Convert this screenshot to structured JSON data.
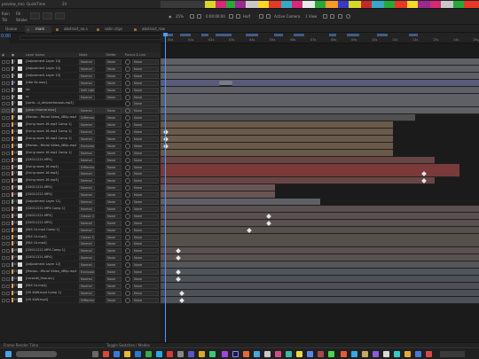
{
  "topbar": {
    "labels": [
      "preview\nrmo",
      "Quick Time",
      "24",
      "00",
      "0:00:00:00",
      "Half",
      "Active Camera",
      "1 View"
    ],
    "title_left": "preview_rmo",
    "quick_time": "QuickTime",
    "frame_value": "24"
  },
  "viewer": {
    "zoom": "25%",
    "timecode_small": "0:00:00:00",
    "resolution": "Half",
    "camera": "Active Camera",
    "views": "1 View",
    "left_items": [
      "Rain",
      "Fill",
      "Tilt",
      "Stroke"
    ]
  },
  "tabs": [
    {
      "label": "Queue",
      "active": false
    },
    {
      "label": "mark",
      "active": true
    },
    {
      "label": "abstract_no.s",
      "active": false
    },
    {
      "label": "satin clips",
      "active": false
    },
    {
      "label": "abstract_raw",
      "active": false
    }
  ],
  "timeline": {
    "timecode": "0:00",
    "headers": {
      "layer_name": "Layer Name",
      "mode": "Mode",
      "trkmat": "TrkMat",
      "parent": "Parent & Link"
    },
    "ruler_labels": [
      "00s",
      "01s",
      "02s",
      "03s",
      "04s",
      "05s",
      "06s",
      "07s",
      "08s",
      "09s",
      "10s",
      "11s",
      "12s",
      "13s",
      "14s",
      "15s"
    ]
  },
  "layers": [
    {
      "num": "1",
      "name": "[Adjustment Layer 10]",
      "mode": "Normal",
      "trk": "None",
      "parent": "None",
      "label_color": "#a4a4a4",
      "icon": "adjustment-icon",
      "bar_color": "#5e6066",
      "bar_start": 0.0,
      "bar_end": 1.0
    },
    {
      "num": "2",
      "name": "[Adjustment Layer 10]",
      "mode": "Normal",
      "trk": "None",
      "parent": "None",
      "label_color": "#a4a4a4",
      "icon": "adjustment-icon",
      "bar_color": "#5e6066",
      "bar_start": 0.0,
      "bar_end": 1.0
    },
    {
      "num": "3",
      "name": "[Adjustment Layer 10]",
      "mode": "Normal",
      "trk": "None",
      "parent": "None",
      "label_color": "#a4a4a4",
      "icon": "adjustment-icon",
      "bar_color": "#5e6066",
      "bar_start": 0.0,
      "bar_end": 1.0
    },
    {
      "num": "4",
      "name": "[title fix.mov]",
      "mode": "Normal",
      "trk": "None",
      "parent": "None",
      "label_color": "#8c8cd8",
      "icon": "footage-icon",
      "bar_color": "#5a5a7a",
      "bar_start": 0.0,
      "bar_end": 1.0
    },
    {
      "num": "5",
      "name": "lut",
      "mode": "Soft Light",
      "trk": "None",
      "parent": "None",
      "label_color": "#a4a4a4",
      "icon": "solid-icon",
      "bar_color": "#5e6066",
      "bar_start": 0.0,
      "bar_end": 1.0
    },
    {
      "num": "6",
      "name": "cc",
      "mode": "Normal",
      "trk": "None",
      "parent": "None",
      "label_color": "#a4a4a4",
      "icon": "solid-icon",
      "bar_color": "#5e6066",
      "bar_start": 0.0,
      "bar_end": 1.0
    },
    {
      "num": "7",
      "name": "[contr...d_deliverthecostı.mp3]",
      "mode": "",
      "trk": "",
      "parent": "None",
      "label_color": "#a4a4a4",
      "icon": "audio-icon",
      "bar_color": "#5e6066",
      "bar_start": 0.0,
      "bar_end": 1.0
    },
    {
      "num": "8",
      "name": "[glow chrome.mov]",
      "mode": "Normal",
      "trk": "None",
      "parent": "None",
      "label_color": "#a4a4a4",
      "icon": "footage-icon",
      "bar_color": "#5e6066",
      "bar_start": 0.0,
      "bar_end": 1.0
    },
    {
      "num": "9",
      "name": "[Marian...ffiicial Video_480p.mp4]",
      "mode": "Differenc",
      "trk": "None",
      "parent": "None",
      "label_color": "#e8a050",
      "icon": "footage-icon",
      "bar_color": "#505050",
      "bar_start": 0.0,
      "bar_end": 0.8
    },
    {
      "num": "10",
      "name": "[living room 16.mp4 Comp 1]",
      "mode": "Normal",
      "trk": "None",
      "parent": "None",
      "label_color": "#e8a050",
      "icon": "comp-icon",
      "bar_color": "#6a5a4a",
      "bar_start": 0.0,
      "bar_end": 0.73
    },
    {
      "num": "11",
      "name": "[living room 16.mp4 Comp 1]",
      "mode": "Normal",
      "trk": "None",
      "parent": "None",
      "label_color": "#e8a050",
      "icon": "comp-icon",
      "bar_color": "#6a5a4a",
      "bar_start": 0.0,
      "bar_end": 0.73
    },
    {
      "num": "12",
      "name": "[living room 16.mp4 Comp 1]",
      "mode": "Normal",
      "trk": "None",
      "parent": "None",
      "label_color": "#e8a050",
      "icon": "comp-icon",
      "bar_color": "#6a5a4a",
      "bar_start": 0.0,
      "bar_end": 0.73
    },
    {
      "num": "13",
      "name": "[Marian...ffiicial Video_480p.mp4]",
      "mode": "Exclusion",
      "trk": "None",
      "parent": "None",
      "label_color": "#e8a050",
      "icon": "footage-icon",
      "bar_color": "#6a5a4a",
      "bar_start": 0.0,
      "bar_end": 0.73
    },
    {
      "num": "14",
      "name": "[living room 16.mp4 Comp 1]",
      "mode": "Normal",
      "trk": "None",
      "parent": "None",
      "label_color": "#e8a050",
      "icon": "comp-icon",
      "bar_color": "#6a5a4a",
      "bar_start": 0.0,
      "bar_end": 0.73
    },
    {
      "num": "15",
      "name": "[GX011221.MP4]",
      "mode": "Normal",
      "trk": "None",
      "parent": "None",
      "label_color": "#d8a0a0",
      "icon": "footage-icon",
      "bar_color": "#6a4545",
      "bar_start": 0.0,
      "bar_end": 0.86
    },
    {
      "num": "16",
      "name": "[living room 16.mp4]",
      "mode": "Differenc",
      "trk": "None",
      "parent": "None",
      "label_color": "#d8a0a0",
      "icon": "footage-icon",
      "bar_color": "#7a3a3a",
      "bar_start": 0.0,
      "bar_end": 0.94
    },
    {
      "num": "17",
      "name": "[living room 16.mp4]",
      "mode": "Normal",
      "trk": "None",
      "parent": "None",
      "label_color": "#d8a0a0",
      "icon": "footage-icon",
      "bar_color": "#7a3a3a",
      "bar_start": 0.0,
      "bar_end": 0.94
    },
    {
      "num": "18",
      "name": "[living room 16.mp4]",
      "mode": "Normal",
      "trk": "None",
      "parent": "None",
      "label_color": "#d8a0a0",
      "icon": "footage-icon",
      "bar_color": "#6a4545",
      "bar_start": 0.0,
      "bar_end": 0.86
    },
    {
      "num": "19",
      "name": "[GX011221.MP4]",
      "mode": "Normal",
      "trk": "None",
      "parent": "None",
      "label_color": "#d8a0a0",
      "icon": "footage-icon",
      "bar_color": "#6a5555",
      "bar_start": 0.0,
      "bar_end": 0.36
    },
    {
      "num": "20",
      "name": "[GX011221.MP4]",
      "mode": "Normal",
      "trk": "None",
      "parent": "None",
      "label_color": "#d8a0a0",
      "icon": "footage-icon",
      "bar_color": "#6a5555",
      "bar_start": 0.0,
      "bar_end": 0.36
    },
    {
      "num": "21",
      "name": "[Adjustment Layer 11]",
      "mode": "Normal",
      "trk": "None",
      "parent": "None",
      "label_color": "#a4a4a4",
      "icon": "adjustment-icon",
      "bar_color": "#5e6066",
      "bar_start": 0.0,
      "bar_end": 0.5
    },
    {
      "num": "22",
      "name": "[GX011221.MP4 Comp 1]",
      "mode": "Normal",
      "trk": "None",
      "parent": "None",
      "label_color": "#d8a0a0",
      "icon": "comp-icon",
      "bar_color": "#5a5050",
      "bar_start": 0.0,
      "bar_end": 1.0
    },
    {
      "num": "23",
      "name": "[GX011221.MP4]",
      "mode": "Classic D",
      "trk": "None",
      "parent": "None",
      "label_color": "#d8a0a0",
      "icon": "footage-icon",
      "bar_color": "#5a5050",
      "bar_start": 0.0,
      "bar_end": 1.0
    },
    {
      "num": "24",
      "name": "[GX011221.MP4]",
      "mode": "Normal",
      "trk": "None",
      "parent": "None",
      "label_color": "#d8a0a0",
      "icon": "footage-icon",
      "bar_color": "#5a5050",
      "bar_start": 0.0,
      "bar_end": 1.0
    },
    {
      "num": "25",
      "name": "[NUI 14.mp4 Comp 1]",
      "mode": "Normal",
      "trk": "None",
      "parent": "None",
      "label_color": "#e8a050",
      "icon": "comp-icon",
      "bar_color": "#55504a",
      "bar_start": 0.0,
      "bar_end": 1.0
    },
    {
      "num": "26",
      "name": "[NUI 14.mp4]",
      "mode": "Classic D",
      "trk": "None",
      "parent": "None",
      "label_color": "#e8a050",
      "icon": "footage-icon",
      "bar_color": "#55504a",
      "bar_start": 0.0,
      "bar_end": 1.0
    },
    {
      "num": "27",
      "name": "[NUI 14.mp4]",
      "mode": "Normal",
      "trk": "None",
      "parent": "None",
      "label_color": "#e8a050",
      "icon": "footage-icon",
      "bar_color": "#55504a",
      "bar_start": 0.0,
      "bar_end": 1.0
    },
    {
      "num": "28",
      "name": "[GX011221.MP4 Comp 1]",
      "mode": "Normal",
      "trk": "None",
      "parent": "None",
      "label_color": "#d8a0a0",
      "icon": "comp-icon",
      "bar_color": "#5a5050",
      "bar_start": 0.0,
      "bar_end": 1.0
    },
    {
      "num": "29",
      "name": "[GX011221.MP4]",
      "mode": "Normal",
      "trk": "None",
      "parent": "None",
      "label_color": "#d8a0a0",
      "icon": "footage-icon",
      "bar_color": "#5a5050",
      "bar_start": 0.0,
      "bar_end": 1.0
    },
    {
      "num": "30",
      "name": "[Adjustment Layer 12]",
      "mode": "Normal",
      "trk": "None",
      "parent": "None",
      "label_color": "#a4a4a4",
      "icon": "adjustment-icon",
      "bar_color": "#55565c",
      "bar_start": 0.0,
      "bar_end": 1.0
    },
    {
      "num": "31",
      "name": "[Marian...ffiicial Video_480p.mp4]",
      "mode": "Exclusion",
      "trk": "None",
      "parent": "None",
      "label_color": "#e8a050",
      "icon": "footage-icon",
      "bar_color": "#50555c",
      "bar_start": 0.0,
      "bar_end": 1.0
    },
    {
      "num": "32",
      "name": "[recordd_final.aiv]",
      "mode": "Normal",
      "trk": "None",
      "parent": "None",
      "label_color": "#a4a4a4",
      "icon": "footage-icon",
      "bar_color": "#4e5058",
      "bar_start": 0.0,
      "bar_end": 1.0
    },
    {
      "num": "33",
      "name": "[NUI 14.mp4]",
      "mode": "Normal",
      "trk": "None",
      "parent": "None",
      "label_color": "#e8a050",
      "icon": "footage-icon",
      "bar_color": "#4e5058",
      "bar_start": 0.0,
      "bar_end": 1.0
    },
    {
      "num": "34",
      "name": "[VX XAW.mp4 Comp 1]",
      "mode": "Normal",
      "trk": "None",
      "parent": "None",
      "label_color": "#e8a050",
      "icon": "comp-icon",
      "bar_color": "#4e5058",
      "bar_start": 0.0,
      "bar_end": 1.0
    },
    {
      "num": "35",
      "name": "[VX XAW.mp4]",
      "mode": "Differenc",
      "trk": "None",
      "parent": "None",
      "label_color": "#e8a050",
      "icon": "footage-icon",
      "bar_color": "#4e5058",
      "bar_start": 0.0,
      "bar_end": 1.0
    }
  ],
  "status": {
    "toggle": "Toggle Switches / Modes",
    "left": "Frame Render Time"
  },
  "colors": {
    "accent": "#4d9bff",
    "panel": "#1f1f1f"
  }
}
